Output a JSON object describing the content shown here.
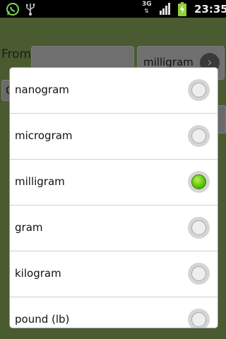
{
  "status_bar": {
    "network": "3G",
    "time": "23:35",
    "icons": [
      "whatsapp-icon",
      "usb-icon",
      "signal-icon",
      "battery-charging-icon"
    ]
  },
  "form": {
    "from_label": "From",
    "from_value": "",
    "from_unit": "milligram",
    "left_button_label": "C"
  },
  "dialog": {
    "options": [
      {
        "label": "nanogram",
        "selected": false
      },
      {
        "label": "microgram",
        "selected": false
      },
      {
        "label": "milligram",
        "selected": true
      },
      {
        "label": "gram",
        "selected": false
      },
      {
        "label": "kilogram",
        "selected": false
      },
      {
        "label": "pound (lb)",
        "selected": false
      }
    ]
  },
  "colors": {
    "app_background": "#4a5a31",
    "radio_selected": "#55c10a"
  }
}
